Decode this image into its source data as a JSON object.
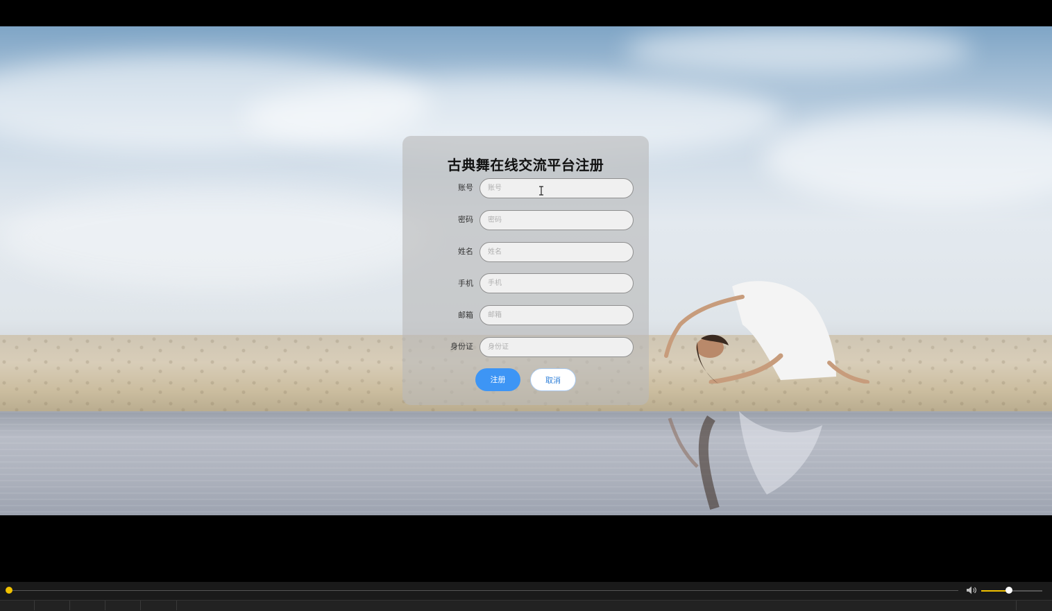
{
  "form": {
    "title": "古典舞在线交流平台注册",
    "fields": [
      {
        "label": "账号",
        "placeholder": "账号",
        "value": ""
      },
      {
        "label": "密码",
        "placeholder": "密码",
        "value": ""
      },
      {
        "label": "姓名",
        "placeholder": "姓名",
        "value": ""
      },
      {
        "label": "手机",
        "placeholder": "手机",
        "value": ""
      },
      {
        "label": "邮箱",
        "placeholder": "邮箱",
        "value": ""
      },
      {
        "label": "身份证",
        "placeholder": "身份证",
        "value": ""
      }
    ],
    "register_label": "注册",
    "cancel_label": "取消"
  },
  "player": {
    "progress_fraction": 0.0,
    "volume_fraction": 0.45,
    "accent_color": "#f2c200",
    "volume_icon": "speaker-icon"
  },
  "colors": {
    "primary_button": "#3d95f5",
    "secondary_button_text": "#2f7fd8"
  },
  "background": {
    "image": "dancer-on-beach"
  }
}
